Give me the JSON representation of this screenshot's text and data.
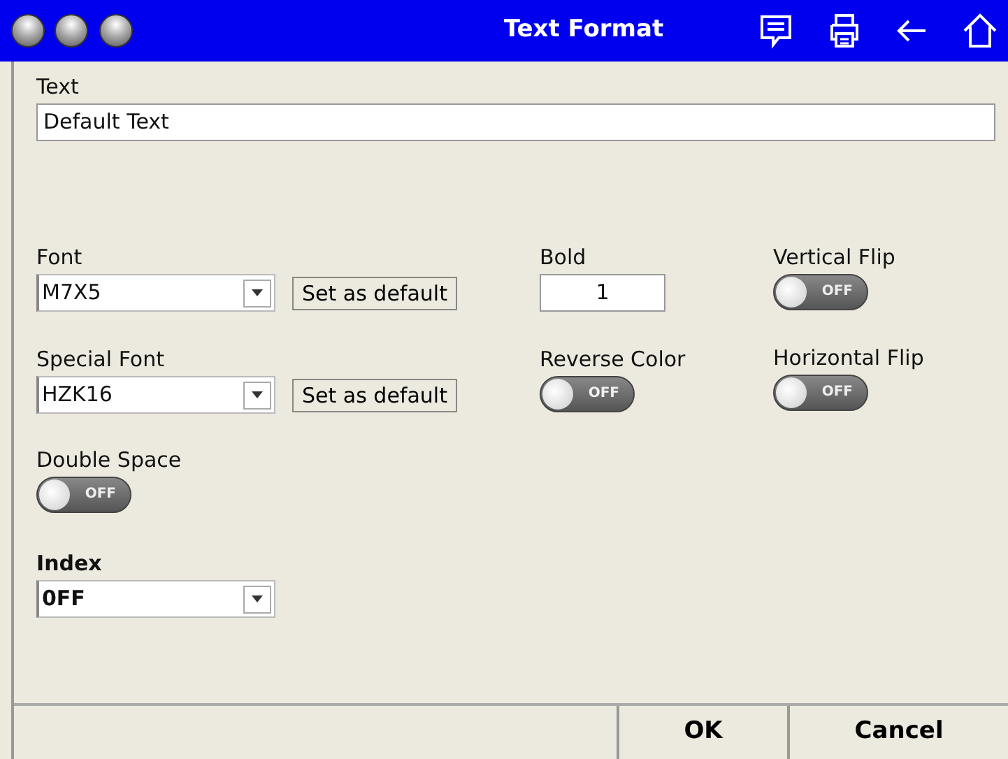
{
  "window": {
    "title": "Text Format"
  },
  "text_field": {
    "label": "Text",
    "value": "Default Text"
  },
  "font": {
    "label": "Font",
    "value": "M7X5",
    "button": "Set as default"
  },
  "bold": {
    "label": "Bold",
    "value": "1"
  },
  "vertical_flip": {
    "label": "Vertical Flip",
    "on": false,
    "state_text": "OFF"
  },
  "special_font": {
    "label": "Special Font",
    "value": "HZK16",
    "button": "Set as default"
  },
  "reverse_color": {
    "label": "Reverse Color",
    "on": false,
    "state_text": "OFF"
  },
  "horizontal_flip": {
    "label": "Horizontal Flip",
    "on": false,
    "state_text": "OFF"
  },
  "double_space": {
    "label": "Double Space",
    "on": false,
    "state_text": "OFF"
  },
  "index": {
    "label": "Index",
    "value": "0FF"
  },
  "buttons": [
    "OK",
    "Cancel"
  ]
}
